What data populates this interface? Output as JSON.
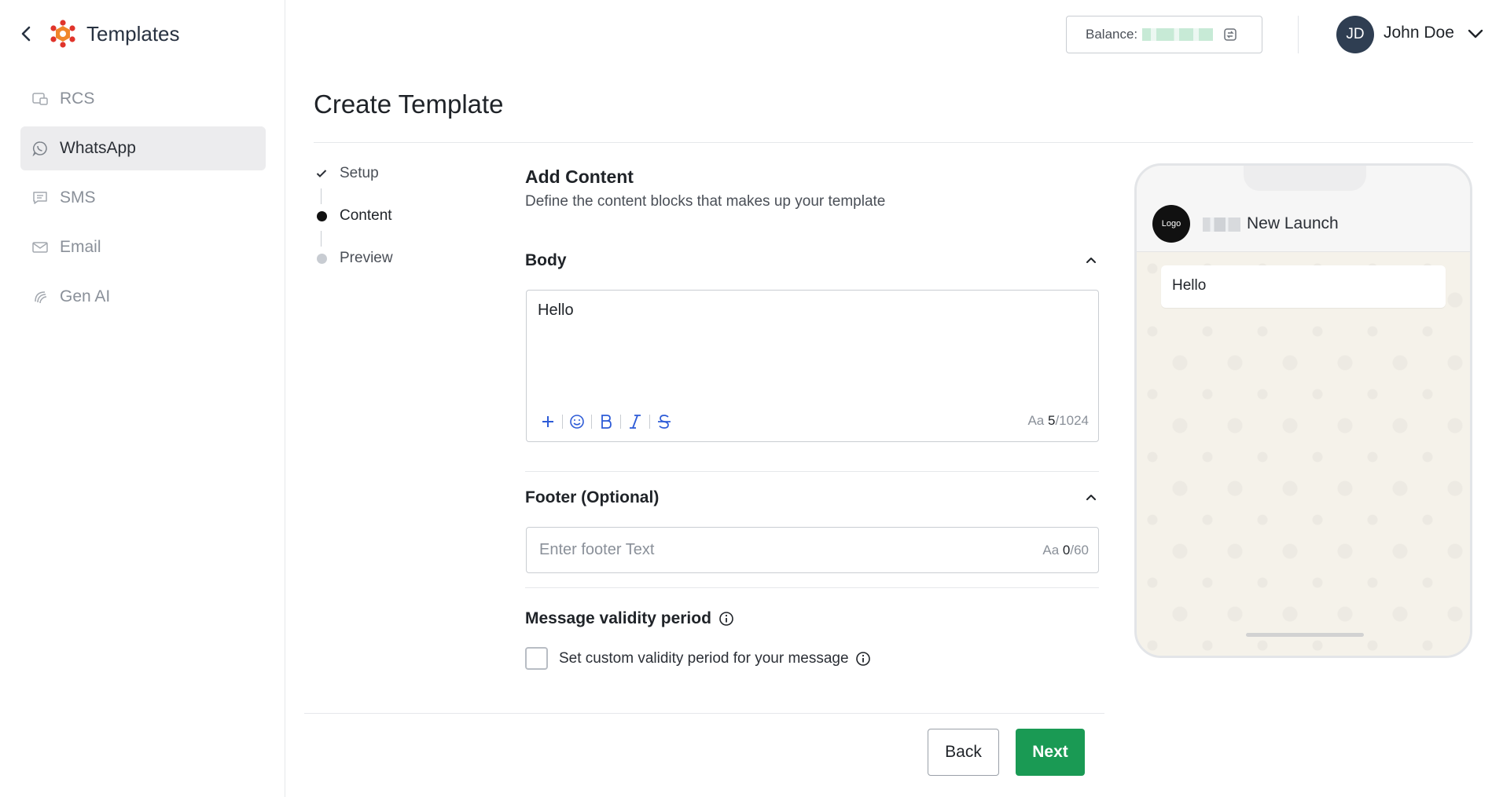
{
  "app": {
    "title": "Templates"
  },
  "sidebar": {
    "items": [
      {
        "label": "RCS",
        "icon": "rcs-icon",
        "active": false
      },
      {
        "label": "WhatsApp",
        "icon": "whatsapp-icon",
        "active": true
      },
      {
        "label": "SMS",
        "icon": "sms-icon",
        "active": false
      },
      {
        "label": "Email",
        "icon": "email-icon",
        "active": false
      },
      {
        "label": "Gen AI",
        "icon": "gen-ai-icon",
        "active": false
      }
    ]
  },
  "header": {
    "balance_label": "Balance:",
    "user": {
      "initials": "JD",
      "name": "John Doe"
    }
  },
  "page": {
    "title": "Create Template"
  },
  "stepper": {
    "steps": [
      {
        "label": "Setup",
        "state": "done"
      },
      {
        "label": "Content",
        "state": "current"
      },
      {
        "label": "Preview",
        "state": "upcoming"
      }
    ]
  },
  "content": {
    "title": "Add Content",
    "subtitle": "Define the content blocks that makes up your template",
    "body": {
      "title": "Body",
      "text": "Hello",
      "counter_prefix": "Aa",
      "count": "5",
      "max": "/1024",
      "toolbar": [
        "plus-icon",
        "emoji-icon",
        "bold-icon",
        "italic-icon",
        "strikethrough-icon"
      ]
    },
    "footer": {
      "title": "Footer (Optional)",
      "placeholder": "Enter footer Text",
      "value": "",
      "counter_prefix": "Aa",
      "count": "0",
      "max": "/60"
    },
    "validity": {
      "title": "Message validity period",
      "checkbox_label": "Set custom validity period for your message",
      "checked": false
    }
  },
  "actions": {
    "back_label": "Back",
    "next_label": "Next"
  },
  "preview": {
    "logo_text": "Logo",
    "business_name": "New Launch",
    "message": "Hello"
  },
  "colors": {
    "primary_button": "#1a9a54",
    "toolbar_icon": "#2d5bd7",
    "avatar_bg": "#2f3e52",
    "active_nav_bg": "#ececee"
  }
}
